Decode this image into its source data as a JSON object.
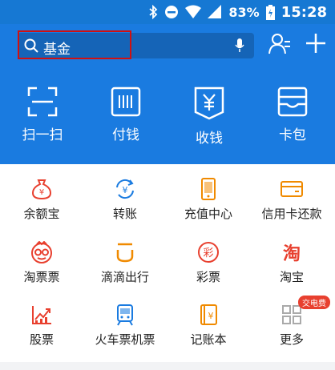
{
  "status": {
    "battery": "83%",
    "time": "15:28"
  },
  "search": {
    "query": "基金"
  },
  "actions": [
    "扫一扫",
    "付钱",
    "收钱",
    "卡包"
  ],
  "grid": [
    {
      "label": "余额宝",
      "icon": "yuebao-icon",
      "color": "#e8402f"
    },
    {
      "label": "转账",
      "icon": "transfer-icon",
      "color": "#1a7be0"
    },
    {
      "label": "充值中心",
      "icon": "phone-recharge-icon",
      "color": "#f08a00"
    },
    {
      "label": "信用卡还款",
      "icon": "credit-card-icon",
      "color": "#f08a00"
    },
    {
      "label": "淘票票",
      "icon": "taopiaopiao-icon",
      "color": "#e8402f"
    },
    {
      "label": "滴滴出行",
      "icon": "didi-icon",
      "color": "#f08a00"
    },
    {
      "label": "彩票",
      "icon": "lottery-icon",
      "color": "#e8402f"
    },
    {
      "label": "淘宝",
      "icon": "taobao-icon",
      "color": "#e8402f"
    },
    {
      "label": "股票",
      "icon": "stock-icon",
      "color": "#e8402f"
    },
    {
      "label": "火车票机票",
      "icon": "train-icon",
      "color": "#1a7be0"
    },
    {
      "label": "记账本",
      "icon": "ledger-icon",
      "color": "#f08a00"
    },
    {
      "label": "更多",
      "icon": "more-icon",
      "color": "#999999"
    }
  ],
  "badge": "交电费",
  "taobao_char": "淘",
  "lottery_char": "彩",
  "yuan": "¥"
}
